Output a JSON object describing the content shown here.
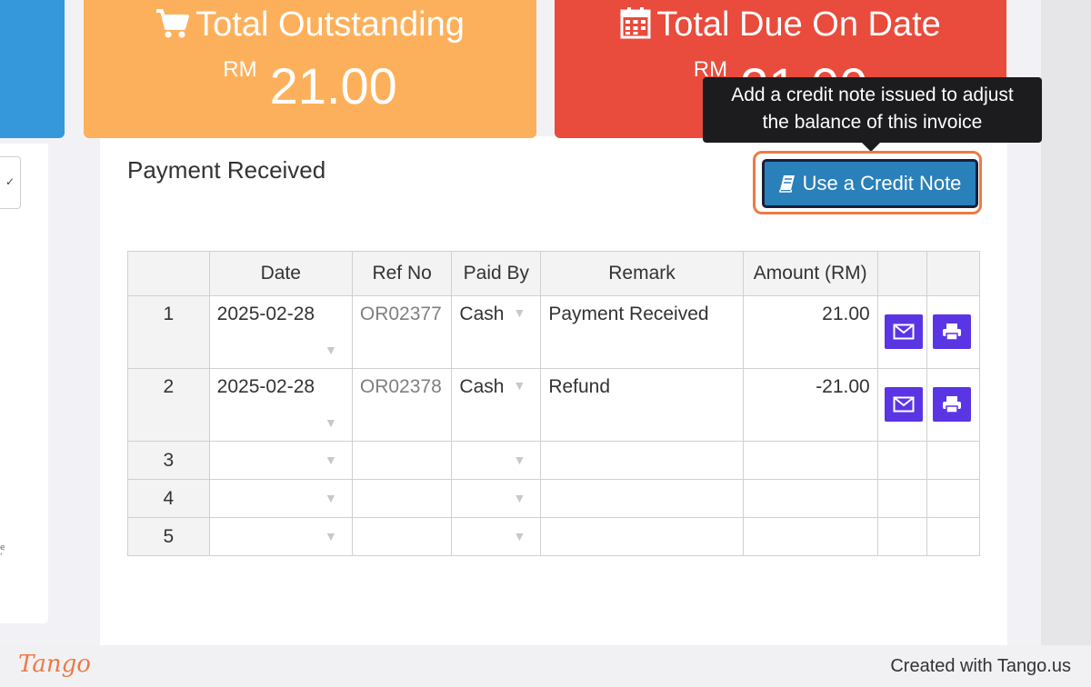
{
  "cards": {
    "outstanding": {
      "title": "Total Outstanding",
      "currency": "RM",
      "amount": "21.00",
      "icon": "shopping-cart-icon",
      "color": "#fdb05c"
    },
    "due": {
      "title": "Total Due On Date",
      "currency": "RM",
      "amount": "21.00",
      "icon": "calendar-icon",
      "color": "#e94b3c"
    }
  },
  "section": {
    "title": "Payment Received"
  },
  "credit_note": {
    "button_label": "Use a Credit Note",
    "icon": "book-icon",
    "tooltip_line1": "Add a credit note issued to adjust",
    "tooltip_line2": "the balance of this invoice",
    "highlight_color": "#ee7a45",
    "button_color": "#2a80b9"
  },
  "table": {
    "headers": [
      "",
      "Date",
      "Ref No",
      "Paid By",
      "Remark",
      "Amount (RM)",
      "",
      ""
    ],
    "rows": [
      {
        "num": "1",
        "date": "2025-02-28",
        "ref": "OR02377",
        "paid_by": "Cash",
        "remark": "Payment Received",
        "amount": "21.00"
      },
      {
        "num": "2",
        "date": "2025-02-28",
        "ref": "OR02378",
        "paid_by": "Cash",
        "remark": "Refund",
        "amount": "-21.00"
      },
      {
        "num": "3",
        "date": "",
        "ref": "",
        "paid_by": "",
        "remark": "",
        "amount": ""
      },
      {
        "num": "4",
        "date": "",
        "ref": "",
        "paid_by": "",
        "remark": "",
        "amount": ""
      },
      {
        "num": "5",
        "date": "",
        "ref": "",
        "paid_by": "",
        "remark": "",
        "amount": ""
      }
    ],
    "action_color": "#5a35e3"
  },
  "footer": {
    "logo": "Tango",
    "credit": "Created with Tango.us"
  }
}
